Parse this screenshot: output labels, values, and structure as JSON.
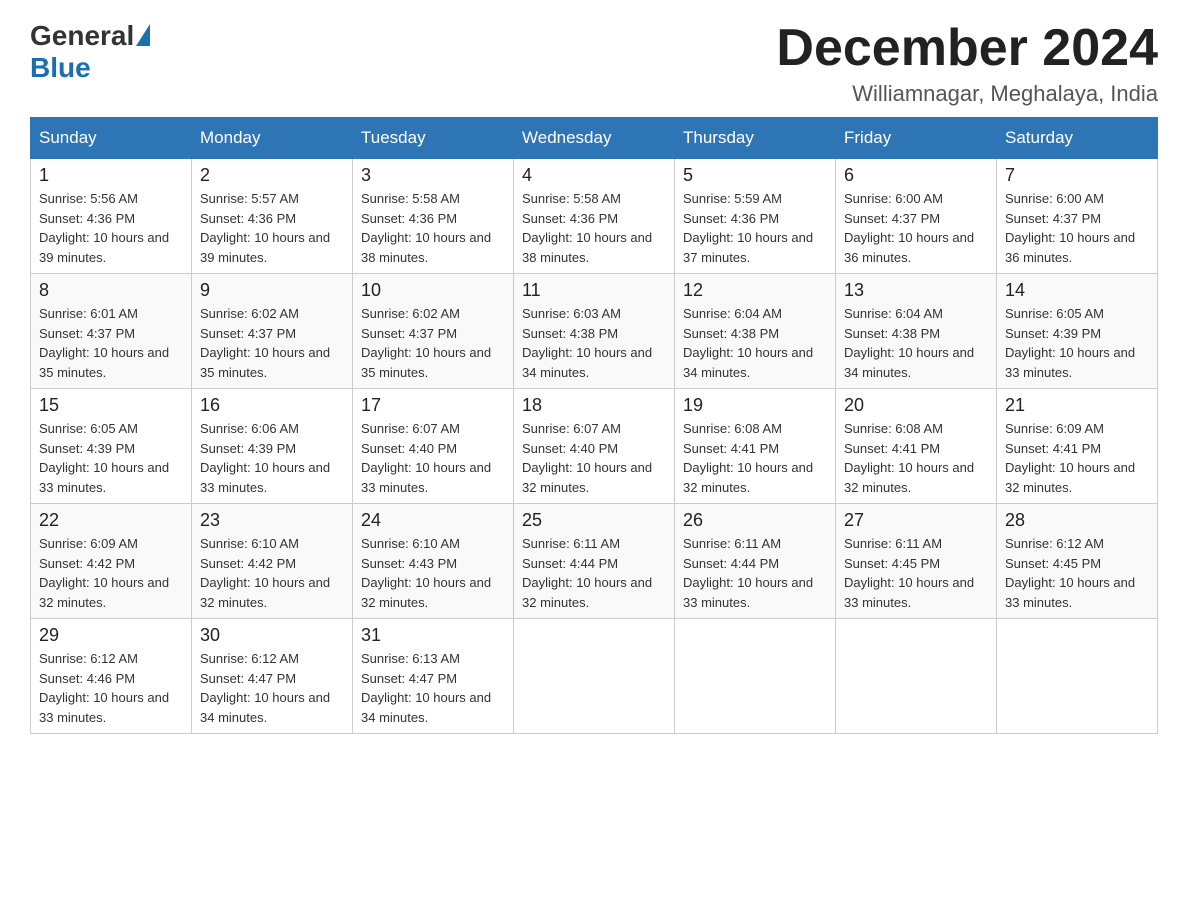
{
  "logo": {
    "general": "General",
    "blue": "Blue"
  },
  "title": "December 2024",
  "location": "Williamnagar, Meghalaya, India",
  "days_of_week": [
    "Sunday",
    "Monday",
    "Tuesday",
    "Wednesday",
    "Thursday",
    "Friday",
    "Saturday"
  ],
  "weeks": [
    [
      {
        "day": "1",
        "sunrise": "5:56 AM",
        "sunset": "4:36 PM",
        "daylight": "10 hours and 39 minutes."
      },
      {
        "day": "2",
        "sunrise": "5:57 AM",
        "sunset": "4:36 PM",
        "daylight": "10 hours and 39 minutes."
      },
      {
        "day": "3",
        "sunrise": "5:58 AM",
        "sunset": "4:36 PM",
        "daylight": "10 hours and 38 minutes."
      },
      {
        "day": "4",
        "sunrise": "5:58 AM",
        "sunset": "4:36 PM",
        "daylight": "10 hours and 38 minutes."
      },
      {
        "day": "5",
        "sunrise": "5:59 AM",
        "sunset": "4:36 PM",
        "daylight": "10 hours and 37 minutes."
      },
      {
        "day": "6",
        "sunrise": "6:00 AM",
        "sunset": "4:37 PM",
        "daylight": "10 hours and 36 minutes."
      },
      {
        "day": "7",
        "sunrise": "6:00 AM",
        "sunset": "4:37 PM",
        "daylight": "10 hours and 36 minutes."
      }
    ],
    [
      {
        "day": "8",
        "sunrise": "6:01 AM",
        "sunset": "4:37 PM",
        "daylight": "10 hours and 35 minutes."
      },
      {
        "day": "9",
        "sunrise": "6:02 AM",
        "sunset": "4:37 PM",
        "daylight": "10 hours and 35 minutes."
      },
      {
        "day": "10",
        "sunrise": "6:02 AM",
        "sunset": "4:37 PM",
        "daylight": "10 hours and 35 minutes."
      },
      {
        "day": "11",
        "sunrise": "6:03 AM",
        "sunset": "4:38 PM",
        "daylight": "10 hours and 34 minutes."
      },
      {
        "day": "12",
        "sunrise": "6:04 AM",
        "sunset": "4:38 PM",
        "daylight": "10 hours and 34 minutes."
      },
      {
        "day": "13",
        "sunrise": "6:04 AM",
        "sunset": "4:38 PM",
        "daylight": "10 hours and 34 minutes."
      },
      {
        "day": "14",
        "sunrise": "6:05 AM",
        "sunset": "4:39 PM",
        "daylight": "10 hours and 33 minutes."
      }
    ],
    [
      {
        "day": "15",
        "sunrise": "6:05 AM",
        "sunset": "4:39 PM",
        "daylight": "10 hours and 33 minutes."
      },
      {
        "day": "16",
        "sunrise": "6:06 AM",
        "sunset": "4:39 PM",
        "daylight": "10 hours and 33 minutes."
      },
      {
        "day": "17",
        "sunrise": "6:07 AM",
        "sunset": "4:40 PM",
        "daylight": "10 hours and 33 minutes."
      },
      {
        "day": "18",
        "sunrise": "6:07 AM",
        "sunset": "4:40 PM",
        "daylight": "10 hours and 32 minutes."
      },
      {
        "day": "19",
        "sunrise": "6:08 AM",
        "sunset": "4:41 PM",
        "daylight": "10 hours and 32 minutes."
      },
      {
        "day": "20",
        "sunrise": "6:08 AM",
        "sunset": "4:41 PM",
        "daylight": "10 hours and 32 minutes."
      },
      {
        "day": "21",
        "sunrise": "6:09 AM",
        "sunset": "4:41 PM",
        "daylight": "10 hours and 32 minutes."
      }
    ],
    [
      {
        "day": "22",
        "sunrise": "6:09 AM",
        "sunset": "4:42 PM",
        "daylight": "10 hours and 32 minutes."
      },
      {
        "day": "23",
        "sunrise": "6:10 AM",
        "sunset": "4:42 PM",
        "daylight": "10 hours and 32 minutes."
      },
      {
        "day": "24",
        "sunrise": "6:10 AM",
        "sunset": "4:43 PM",
        "daylight": "10 hours and 32 minutes."
      },
      {
        "day": "25",
        "sunrise": "6:11 AM",
        "sunset": "4:44 PM",
        "daylight": "10 hours and 32 minutes."
      },
      {
        "day": "26",
        "sunrise": "6:11 AM",
        "sunset": "4:44 PM",
        "daylight": "10 hours and 33 minutes."
      },
      {
        "day": "27",
        "sunrise": "6:11 AM",
        "sunset": "4:45 PM",
        "daylight": "10 hours and 33 minutes."
      },
      {
        "day": "28",
        "sunrise": "6:12 AM",
        "sunset": "4:45 PM",
        "daylight": "10 hours and 33 minutes."
      }
    ],
    [
      {
        "day": "29",
        "sunrise": "6:12 AM",
        "sunset": "4:46 PM",
        "daylight": "10 hours and 33 minutes."
      },
      {
        "day": "30",
        "sunrise": "6:12 AM",
        "sunset": "4:47 PM",
        "daylight": "10 hours and 34 minutes."
      },
      {
        "day": "31",
        "sunrise": "6:13 AM",
        "sunset": "4:47 PM",
        "daylight": "10 hours and 34 minutes."
      },
      null,
      null,
      null,
      null
    ]
  ]
}
